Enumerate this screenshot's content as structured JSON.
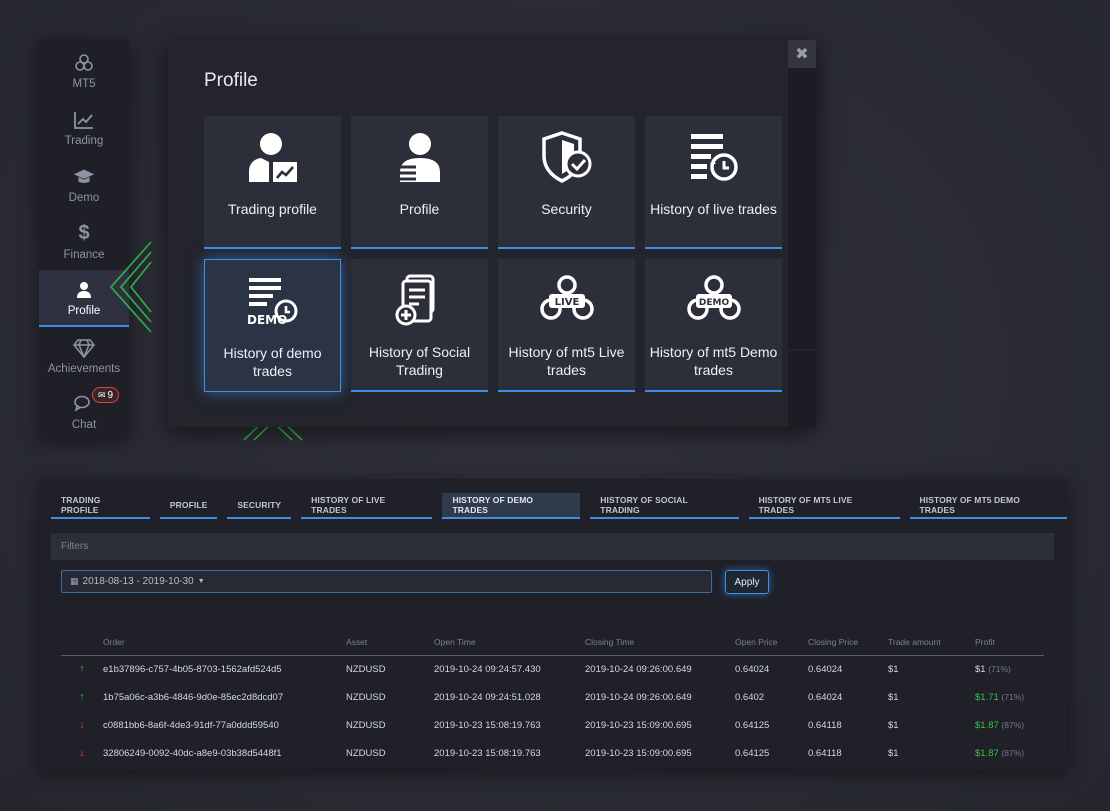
{
  "sidebar": {
    "items": [
      {
        "label": "MT5",
        "icon": "mt5-icon"
      },
      {
        "label": "Trading",
        "icon": "trading-chart-icon"
      },
      {
        "label": "Demo",
        "icon": "graduation-cap-icon"
      },
      {
        "label": "Finance",
        "icon": "dollar-icon"
      },
      {
        "label": "Profile",
        "icon": "user-icon",
        "active": true
      },
      {
        "label": "Achievements",
        "icon": "diamond-icon"
      },
      {
        "label": "Chat",
        "icon": "chat-icon"
      }
    ],
    "chat_badge": "9"
  },
  "modal": {
    "title": "Profile",
    "close_symbol": "✖",
    "tiles": [
      {
        "label": "Trading profile",
        "icon": "trading-profile-icon"
      },
      {
        "label": "Profile",
        "icon": "profile-icon"
      },
      {
        "label": "Security",
        "icon": "security-shield-icon"
      },
      {
        "label": "History of live trades",
        "icon": "history-live-icon"
      },
      {
        "label": "History of demo trades",
        "icon": "history-demo-icon",
        "selected": true,
        "icon_text": "DEMO"
      },
      {
        "label": "History of Social Trading",
        "icon": "social-trading-icon"
      },
      {
        "label": "History of mt5 Live trades",
        "icon": "mt5-live-icon",
        "icon_text": "LIVE"
      },
      {
        "label": "History of mt5 Demo trades",
        "icon": "mt5-demo-icon",
        "icon_text": "DEMO"
      }
    ]
  },
  "panel": {
    "tabs": [
      {
        "label": "TRADING PROFILE"
      },
      {
        "label": "PROFILE"
      },
      {
        "label": "SECURITY"
      },
      {
        "label": "HISTORY OF LIVE TRADES"
      },
      {
        "label": "HISTORY OF DEMO TRADES",
        "active": true
      },
      {
        "label": "HISTORY OF SOCIAL TRADING"
      },
      {
        "label": "HISTORY OF MT5 LIVE TRADES"
      },
      {
        "label": "HISTORY OF MT5 DEMO TRADES"
      }
    ],
    "filters_label": "Filters",
    "date_range": "2018-08-13 - 2019-10-30",
    "apply_label": "Apply",
    "columns": [
      "Order",
      "Asset",
      "Open Time",
      "Closing Time",
      "Open Price",
      "Closing Price",
      "Trade amount",
      "Profit"
    ],
    "rows": [
      {
        "direction": "up",
        "arrow": "↑",
        "order": "e1b37896-c757-4b05-8703-1562afd524d5",
        "asset": "NZDUSD",
        "open_time": "2019-10-24 09:24:57.430",
        "closing_time": "2019-10-24 09:26:00.649",
        "open_price": "0.64024",
        "closing_price": "0.64024",
        "amount": "$1",
        "profit": "$1",
        "profit_pct": "(71%)",
        "profit_green": false
      },
      {
        "direction": "up",
        "arrow": "↑",
        "order": "1b75a06c-a3b6-4846-9d0e-85ec2d8dcd07",
        "asset": "NZDUSD",
        "open_time": "2019-10-24 09:24:51.028",
        "closing_time": "2019-10-24 09:26:00.649",
        "open_price": "0.6402",
        "closing_price": "0.64024",
        "amount": "$1",
        "profit": "$1.71",
        "profit_pct": "(71%)",
        "profit_green": true
      },
      {
        "direction": "down",
        "arrow": "↓",
        "order": "c0881bb6-8a6f-4de3-91df-77a0ddd59540",
        "asset": "NZDUSD",
        "open_time": "2019-10-23 15:08:19.763",
        "closing_time": "2019-10-23 15:09:00.695",
        "open_price": "0.64125",
        "closing_price": "0.64118",
        "amount": "$1",
        "profit": "$1.87",
        "profit_pct": "(87%)",
        "profit_green": true
      },
      {
        "direction": "down",
        "arrow": "↓",
        "order": "32806249-0092-40dc-a8e9-03b38d5448f1",
        "asset": "NZDUSD",
        "open_time": "2019-10-23 15:08:19.763",
        "closing_time": "2019-10-23 15:09:00.695",
        "open_price": "0.64125",
        "closing_price": "0.64118",
        "amount": "$1",
        "profit": "$1.87",
        "profit_pct": "(87%)",
        "profit_green": true
      }
    ]
  },
  "colors": {
    "accent": "#3c8ee6",
    "green": "#3cc04a",
    "red": "#e24b32",
    "arrow_green": "#2fc24a"
  }
}
